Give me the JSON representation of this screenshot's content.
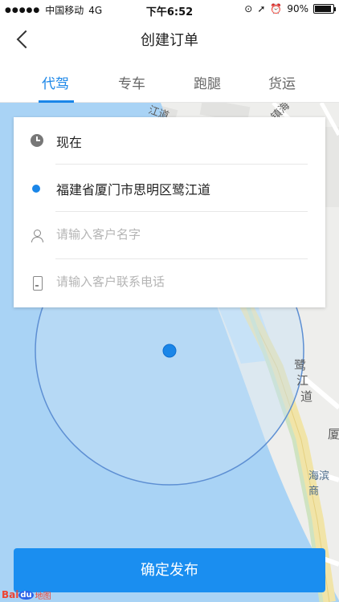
{
  "status_bar": {
    "carrier": "中国移动",
    "network": "4G",
    "time": "下午6:52",
    "battery": "90%",
    "battery_level": 0.9
  },
  "nav": {
    "title": "创建订单"
  },
  "tabs": [
    {
      "label": "代驾",
      "active": true
    },
    {
      "label": "专车",
      "active": false
    },
    {
      "label": "跑腿",
      "active": false
    },
    {
      "label": "货运",
      "active": false
    }
  ],
  "form": {
    "time_value": "现在",
    "address_value": "福建省厦门市思明区鹭江道",
    "name_placeholder": "请输入客户名字",
    "phone_placeholder": "请输入客户联系电话"
  },
  "map": {
    "labels": [
      "江道",
      "镇海",
      "鹭",
      "江",
      "道",
      "厦",
      "海滨商"
    ],
    "logo_text": "Bai",
    "logo_du": "du",
    "logo_ditu": "地图"
  },
  "confirm_button": "确定发布",
  "colors": {
    "accent": "#1a86e8",
    "button": "#1a8ef0",
    "water": "#a9d3f5",
    "radius_fill": "#c6dff6"
  }
}
